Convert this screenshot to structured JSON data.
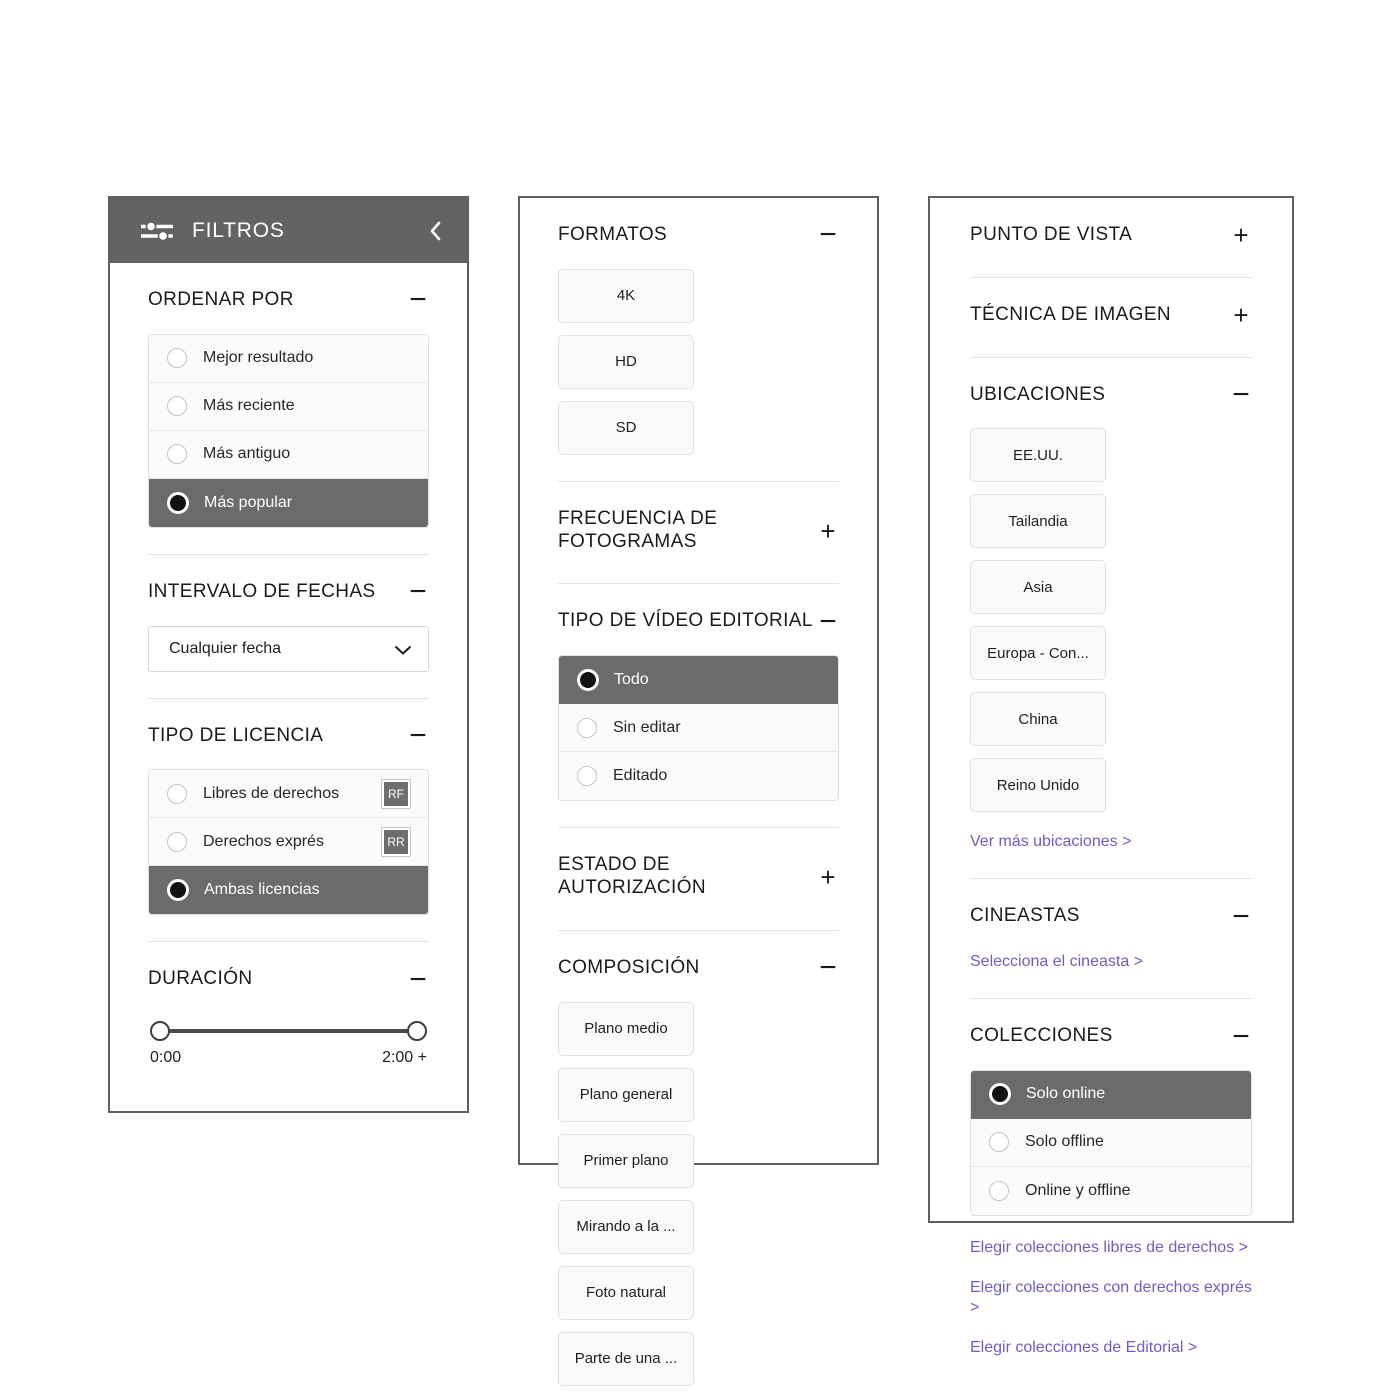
{
  "colors": {
    "header_bg": "#636363",
    "selected_row": "#6b6b6b",
    "link": "#6e5ec4",
    "panel_border": "#5f5f5f"
  },
  "filters_panel": {
    "header": {
      "title": "FILTROS",
      "icon": "sliders-icon",
      "collapse_icon": "chevron-left-icon"
    },
    "sort": {
      "title": "ORDENAR POR",
      "toggle": "−",
      "options": [
        {
          "label": "Mejor resultado",
          "selected": false
        },
        {
          "label": "Más reciente",
          "selected": false
        },
        {
          "label": "Más antiguo",
          "selected": false
        },
        {
          "label": "Más popular",
          "selected": true
        }
      ]
    },
    "date_range": {
      "title": "INTERVALO DE FECHAS",
      "toggle": "−",
      "select_value": "Cualquier fecha"
    },
    "license": {
      "title": "TIPO DE LICENCIA",
      "toggle": "−",
      "options": [
        {
          "label": "Libres de derechos",
          "badge": "RF",
          "selected": false
        },
        {
          "label": "Derechos exprés",
          "badge": "RR",
          "selected": false
        },
        {
          "label": "Ambas licencias",
          "badge": "",
          "selected": true
        }
      ]
    },
    "duration": {
      "title": "DURACIÓN",
      "toggle": "−",
      "min_label": "0:00",
      "max_label": "2:00 +"
    }
  },
  "middle_panel": {
    "formats": {
      "title": "FORMATOS",
      "toggle": "−",
      "chips": [
        "4K",
        "HD",
        "SD"
      ]
    },
    "frame_rate": {
      "title": "FRECUENCIA DE FOTOGRAMAS",
      "toggle": "+"
    },
    "editorial_video_type": {
      "title": "TIPO DE VÍDEO EDITORIAL",
      "toggle": "−",
      "options": [
        {
          "label": "Todo",
          "selected": true
        },
        {
          "label": "Sin editar",
          "selected": false
        },
        {
          "label": "Editado",
          "selected": false
        }
      ]
    },
    "release_status": {
      "title": "ESTADO DE AUTORIZACIÓN",
      "toggle": "+"
    },
    "composition": {
      "title": "COMPOSICIÓN",
      "toggle": "−",
      "chips": [
        "Plano medio",
        "Plano general",
        "Primer plano",
        "Mirando a la ...",
        "Foto natural",
        "Parte de una ..."
      ]
    }
  },
  "right_panel": {
    "viewpoint": {
      "title": "PUNTO DE VISTA",
      "toggle": "+"
    },
    "image_technique": {
      "title": "TÉCNICA DE IMAGEN",
      "toggle": "+"
    },
    "locations": {
      "title": "UBICACIONES",
      "toggle": "−",
      "chips": [
        "EE.UU.",
        "Tailandia",
        "Asia",
        "Europa - Con...",
        "China",
        "Reino Unido"
      ],
      "link": "Ver más ubicaciones >"
    },
    "filmmakers": {
      "title": "CINEASTAS",
      "toggle": "−",
      "link": "Selecciona el cineasta >"
    },
    "collections": {
      "title": "COLECCIONES",
      "toggle": "−",
      "options": [
        {
          "label": "Solo online",
          "selected": true
        },
        {
          "label": "Solo offline",
          "selected": false
        },
        {
          "label": "Online y offline",
          "selected": false
        }
      ],
      "links": [
        "Elegir colecciones libres de derechos >",
        "Elegir colecciones con derechos exprés >",
        "Elegir colecciones de Editorial >"
      ]
    }
  }
}
